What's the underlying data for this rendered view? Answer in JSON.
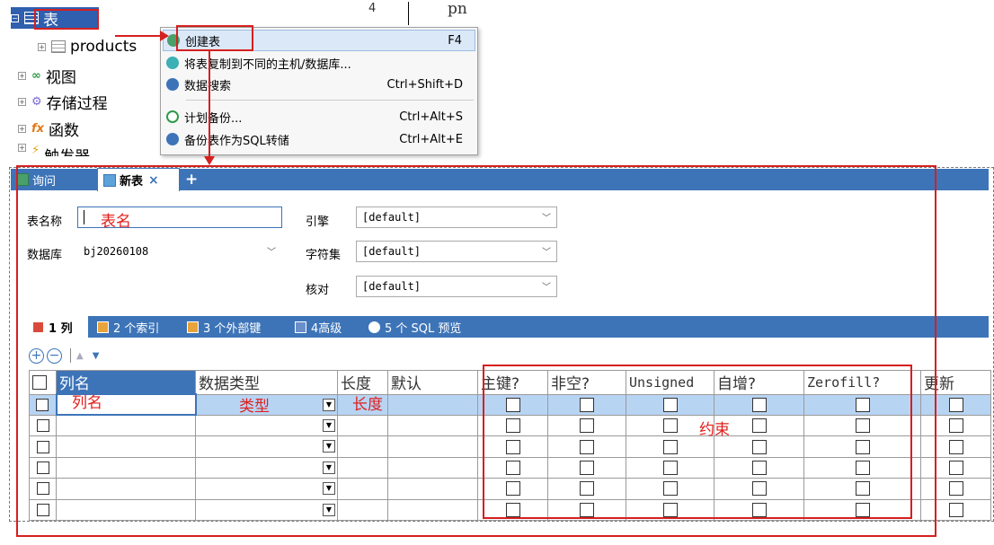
{
  "tree": {
    "selected_label": "表",
    "products_label": "products",
    "views_label": "视图",
    "procs_label": "存储过程",
    "funcs_label": "函数",
    "triggers_label": "触发器",
    "partial_col_value": "4",
    "partial_col_text": "pn"
  },
  "context_menu": {
    "items": [
      {
        "label": "创建表",
        "shortcut": "F4"
      },
      {
        "label": "将表复制到不同的主机/数据库...",
        "shortcut": ""
      },
      {
        "label": "数据搜索",
        "shortcut": "Ctrl+Shift+D"
      },
      {
        "label": "计划备份...",
        "shortcut": "Ctrl+Alt+S"
      },
      {
        "label": "备份表作为SQL转储",
        "shortcut": "Ctrl+Alt+E"
      }
    ]
  },
  "tabs": {
    "query_label": "询问",
    "new_table_label": "新表",
    "close_glyph": "×",
    "add_glyph": "+"
  },
  "form": {
    "table_name_label": "表名称",
    "database_label": "数据库",
    "database_value": "bj20260108",
    "engine_label": "引擎",
    "engine_value": "[default]",
    "charset_label": "字符集",
    "charset_value": "[default]",
    "collation_label": "核对",
    "collation_value": "[default]"
  },
  "subtabs": {
    "columns": "1 列",
    "indexes": "2 个索引",
    "foreign_keys": "3 个外部键",
    "advanced": "4高级",
    "sql_preview": "5 个 SQL 预览"
  },
  "grid": {
    "headers": [
      "列名",
      "数据类型",
      "长度",
      "默认",
      "主键?",
      "非空?",
      "Unsigned",
      "自增?",
      "Zerofill?",
      "更新"
    ]
  },
  "annotations": {
    "table_name": "表名",
    "column_name": "列名",
    "data_type": "类型",
    "length": "长度",
    "constraints": "约束"
  }
}
